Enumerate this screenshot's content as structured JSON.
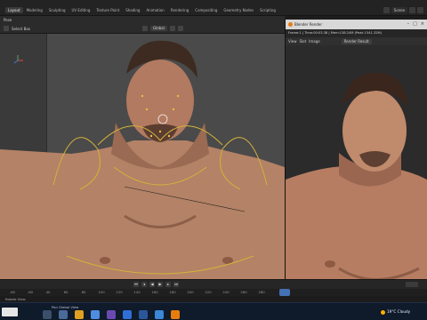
{
  "workspace_tabs": [
    "Layout",
    "Modeling",
    "Sculpting",
    "UV Editing",
    "Texture Paint",
    "Shading",
    "Animation",
    "Rendering",
    "Compositing",
    "Geometry Nodes",
    "Scripting"
  ],
  "active_tab_index": 0,
  "top_right": {
    "scene_label": "Scene"
  },
  "viewport_header": {
    "mode": "Pose",
    "orientation": "Global",
    "select": "Select Box"
  },
  "render_window": {
    "title": "Blender Render",
    "info": "Frame:1 | Time:00:03.38 | Mem:138.24M (Peak 1541.32M)",
    "menu": [
      "View",
      "Slot",
      "Image"
    ],
    "result_label": "Render Result"
  },
  "timeline": {
    "ticks": [
      "-80",
      "-60",
      "40",
      "60",
      "80",
      "100",
      "120",
      "140",
      "160",
      "180",
      "200",
      "220",
      "240",
      "260",
      "280"
    ],
    "status_text": "Rotate View"
  },
  "taskbar": {
    "search_text": "Select Box",
    "status_item": "Pan Global View",
    "weather": "19°C  Cloudy"
  },
  "colors": {
    "ui_bg": "#232323",
    "viewport_bg": "#3a3a3a",
    "accent_active": "#4470b5",
    "bone_yellow": "#d3b23a",
    "taskbar_bg": "#0f1a2a",
    "blender_orange": "#e87d0d"
  }
}
